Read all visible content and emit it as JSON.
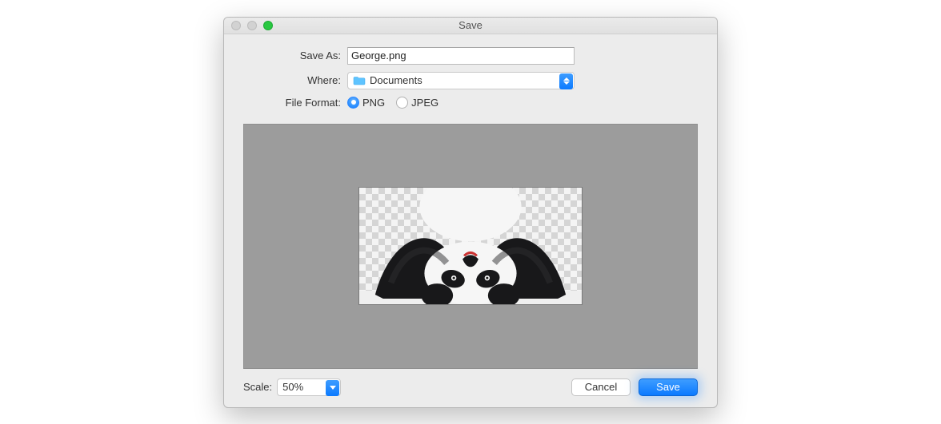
{
  "window": {
    "title": "Save"
  },
  "form": {
    "save_as_label": "Save As:",
    "save_as_value": "George.png",
    "where_label": "Where:",
    "where_value": "Documents",
    "format_label": "File Format:",
    "format_options": {
      "png": "PNG",
      "jpeg": "JPEG"
    },
    "format_selected": "png"
  },
  "preview": {
    "description": "upside-down panda image with transparent background"
  },
  "footer": {
    "scale_label": "Scale:",
    "scale_value": "50%",
    "cancel_label": "Cancel",
    "save_label": "Save"
  }
}
